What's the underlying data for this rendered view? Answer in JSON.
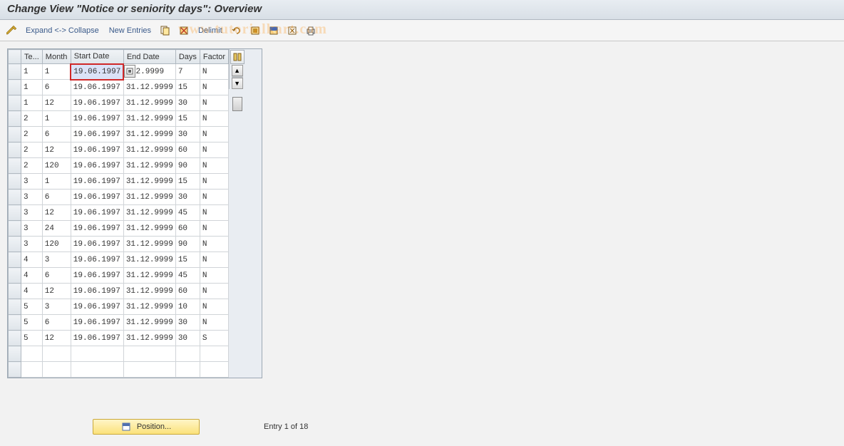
{
  "title": "Change View \"Notice or seniority days\": Overview",
  "toolbar": {
    "expand_collapse": "Expand <-> Collapse",
    "new_entries": "New Entries",
    "delimit": "Delimit"
  },
  "watermark": "www.tutorialkart.com",
  "columns": {
    "rowsel": "",
    "te": "Te...",
    "month": "Month",
    "start": "Start Date",
    "end": "End Date",
    "days": "Days",
    "factor": "Factor"
  },
  "rows": [
    {
      "te": "1",
      "month": "1",
      "start": "19.06.1997",
      "end": ".12.9999",
      "days": "7",
      "factor": "N",
      "active": true
    },
    {
      "te": "1",
      "month": "6",
      "start": "19.06.1997",
      "end": "31.12.9999",
      "days": "15",
      "factor": "N"
    },
    {
      "te": "1",
      "month": "12",
      "start": "19.06.1997",
      "end": "31.12.9999",
      "days": "30",
      "factor": "N"
    },
    {
      "te": "2",
      "month": "1",
      "start": "19.06.1997",
      "end": "31.12.9999",
      "days": "15",
      "factor": "N"
    },
    {
      "te": "2",
      "month": "6",
      "start": "19.06.1997",
      "end": "31.12.9999",
      "days": "30",
      "factor": "N"
    },
    {
      "te": "2",
      "month": "12",
      "start": "19.06.1997",
      "end": "31.12.9999",
      "days": "60",
      "factor": "N"
    },
    {
      "te": "2",
      "month": "120",
      "start": "19.06.1997",
      "end": "31.12.9999",
      "days": "90",
      "factor": "N"
    },
    {
      "te": "3",
      "month": "1",
      "start": "19.06.1997",
      "end": "31.12.9999",
      "days": "15",
      "factor": "N"
    },
    {
      "te": "3",
      "month": "6",
      "start": "19.06.1997",
      "end": "31.12.9999",
      "days": "30",
      "factor": "N"
    },
    {
      "te": "3",
      "month": "12",
      "start": "19.06.1997",
      "end": "31.12.9999",
      "days": "45",
      "factor": "N"
    },
    {
      "te": "3",
      "month": "24",
      "start": "19.06.1997",
      "end": "31.12.9999",
      "days": "60",
      "factor": "N"
    },
    {
      "te": "3",
      "month": "120",
      "start": "19.06.1997",
      "end": "31.12.9999",
      "days": "90",
      "factor": "N"
    },
    {
      "te": "4",
      "month": "3",
      "start": "19.06.1997",
      "end": "31.12.9999",
      "days": "15",
      "factor": "N"
    },
    {
      "te": "4",
      "month": "6",
      "start": "19.06.1997",
      "end": "31.12.9999",
      "days": "45",
      "factor": "N"
    },
    {
      "te": "4",
      "month": "12",
      "start": "19.06.1997",
      "end": "31.12.9999",
      "days": "60",
      "factor": "N"
    },
    {
      "te": "5",
      "month": "3",
      "start": "19.06.1997",
      "end": "31.12.9999",
      "days": "10",
      "factor": "N"
    },
    {
      "te": "5",
      "month": "6",
      "start": "19.06.1997",
      "end": "31.12.9999",
      "days": "30",
      "factor": "N"
    },
    {
      "te": "5",
      "month": "12",
      "start": "19.06.1997",
      "end": "31.12.9999",
      "days": "30",
      "factor": "S"
    },
    {
      "te": "",
      "month": "",
      "start": "",
      "end": "",
      "days": "",
      "factor": ""
    },
    {
      "te": "",
      "month": "",
      "start": "",
      "end": "",
      "days": "",
      "factor": ""
    }
  ],
  "footer": {
    "position_label": "Position...",
    "entry_text": "Entry 1 of 18"
  }
}
